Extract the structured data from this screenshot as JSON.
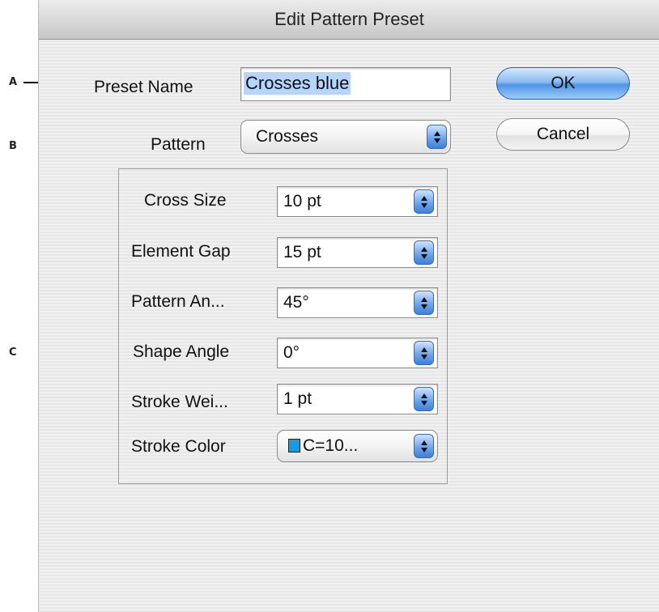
{
  "dialog": {
    "title": "Edit Pattern Preset"
  },
  "callouts": {
    "a": "A",
    "b": "B",
    "c": "C"
  },
  "preset_name": {
    "label": "Preset Name",
    "value": "Crosses blue"
  },
  "pattern": {
    "label": "Pattern",
    "value": "Crosses"
  },
  "buttons": {
    "ok": "OK",
    "cancel": "Cancel"
  },
  "options": {
    "cross_size": {
      "label": "Cross Size",
      "value": "10 pt"
    },
    "element_gap": {
      "label": "Element Gap",
      "value": "15 pt"
    },
    "pattern_angle": {
      "label": "Pattern An...",
      "value": "45°"
    },
    "shape_angle": {
      "label": "Shape Angle",
      "value": "0°"
    },
    "stroke_weight": {
      "label": "Stroke Wei...",
      "value": "1 pt"
    },
    "stroke_color": {
      "label": "Stroke Color",
      "value": "C=10...",
      "swatch_color": "#1a9be0"
    }
  },
  "colors": {
    "ok_button_accent": "#4f95e6",
    "stepper_accent": "#3e7fd9",
    "selection_highlight": "#b5d5ff"
  }
}
